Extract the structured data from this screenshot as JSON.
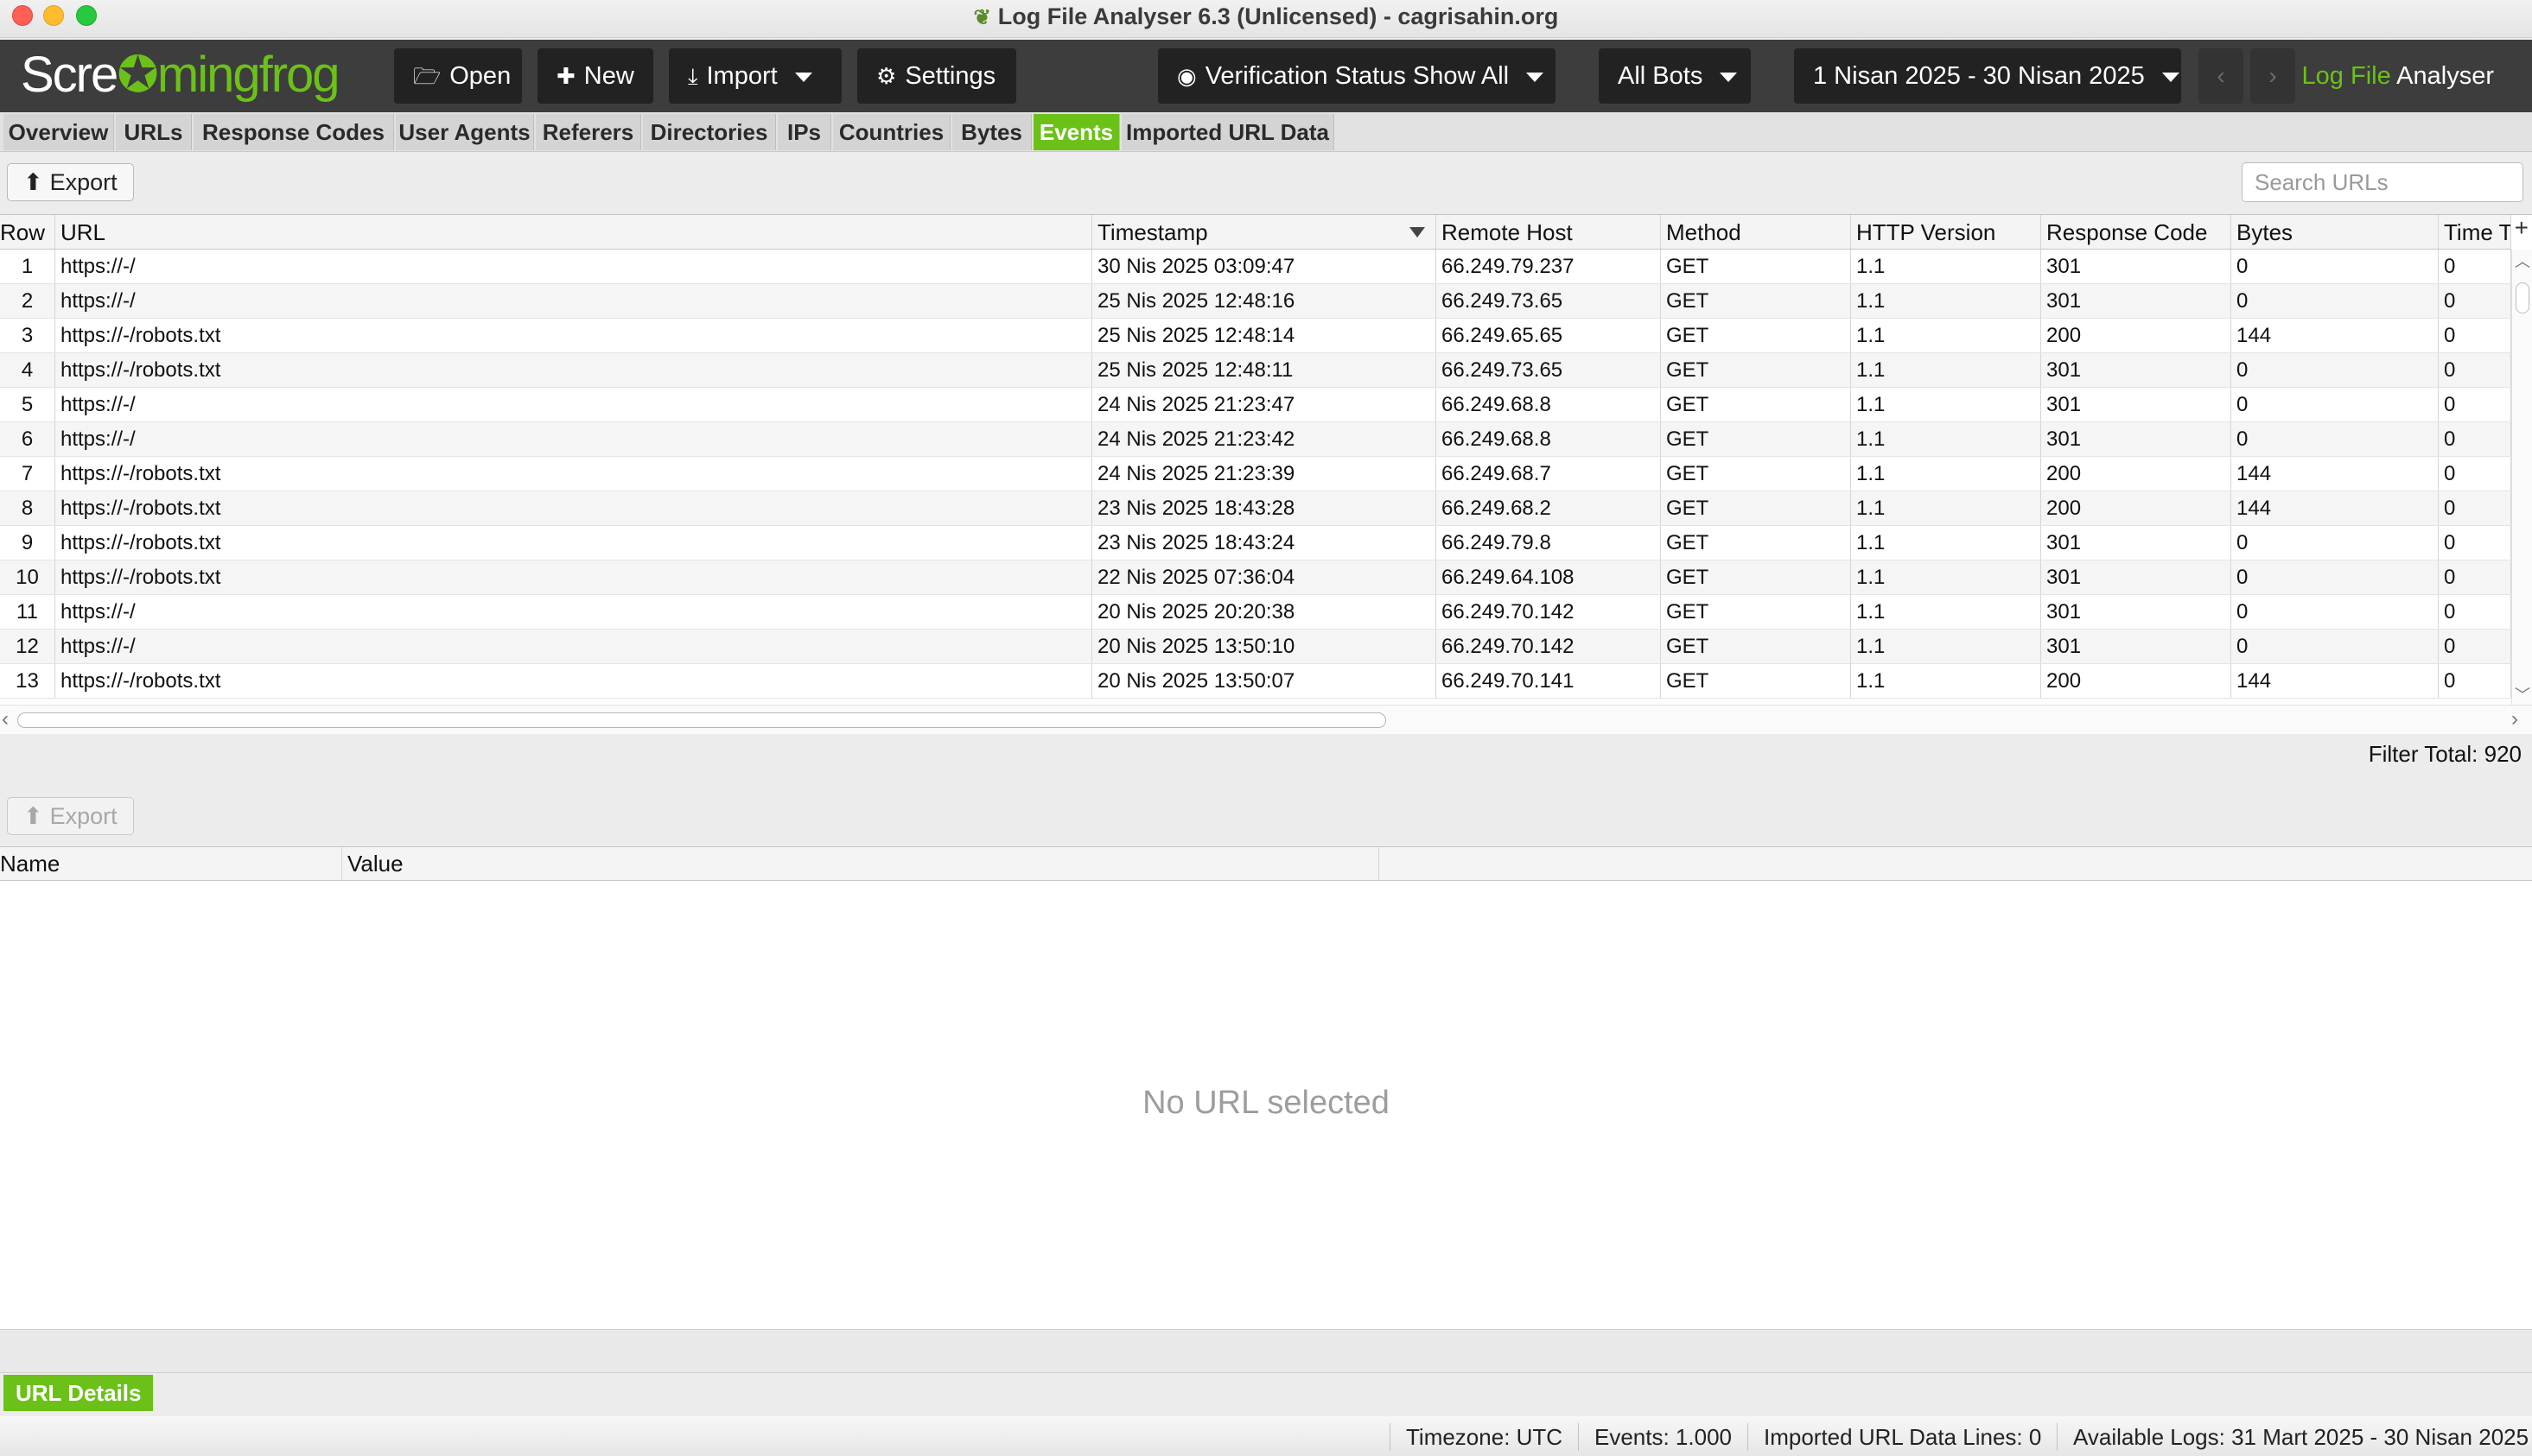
{
  "window": {
    "title": "Log File Analyser 6.3 (Unlicensed) - cagrisahin.org",
    "app_icon": "frog-icon"
  },
  "toolbar": {
    "logo_before": "Scre",
    "logo_glyph": "✪",
    "logo_after": "mingfrog",
    "open_label": "Open",
    "new_label": "New",
    "import_label": "Import",
    "settings_label": "Settings",
    "verification_label": "Verification Status Show All",
    "bots_label": "All Bots",
    "date_range_label": "1 Nisan 2025 - 30 Nisan 2025",
    "prev_glyph": "‹",
    "next_glyph": "›",
    "brand_green": "Log File",
    "brand_white": "Analyser"
  },
  "tabs": [
    {
      "label": "Overview"
    },
    {
      "label": "URLs"
    },
    {
      "label": "Response Codes"
    },
    {
      "label": "User Agents"
    },
    {
      "label": "Referers"
    },
    {
      "label": "Directories"
    },
    {
      "label": "IPs"
    },
    {
      "label": "Countries"
    },
    {
      "label": "Bytes"
    },
    {
      "label": "Events"
    },
    {
      "label": "Imported URL Data"
    }
  ],
  "active_tab": "Events",
  "top_panel": {
    "export_label": "Export",
    "search_placeholder": "Search URLs",
    "filter_total": "Filter Total: 920"
  },
  "table": {
    "columns": [
      "Row",
      "URL",
      "Timestamp",
      "Remote Host",
      "Method",
      "HTTP Version",
      "Response Code",
      "Bytes",
      "Time T"
    ],
    "rows": [
      [
        "1",
        "https://-/",
        "30 Nis 2025 03:09:47",
        "66.249.79.237",
        "GET",
        "1.1",
        "301",
        "0",
        "0"
      ],
      [
        "2",
        "https://-/",
        "25 Nis 2025 12:48:16",
        "66.249.73.65",
        "GET",
        "1.1",
        "301",
        "0",
        "0"
      ],
      [
        "3",
        "https://-/robots.txt",
        "25 Nis 2025 12:48:14",
        "66.249.65.65",
        "GET",
        "1.1",
        "200",
        "144",
        "0"
      ],
      [
        "4",
        "https://-/robots.txt",
        "25 Nis 2025 12:48:11",
        "66.249.73.65",
        "GET",
        "1.1",
        "301",
        "0",
        "0"
      ],
      [
        "5",
        "https://-/",
        "24 Nis 2025 21:23:47",
        "66.249.68.8",
        "GET",
        "1.1",
        "301",
        "0",
        "0"
      ],
      [
        "6",
        "https://-/",
        "24 Nis 2025 21:23:42",
        "66.249.68.8",
        "GET",
        "1.1",
        "301",
        "0",
        "0"
      ],
      [
        "7",
        "https://-/robots.txt",
        "24 Nis 2025 21:23:39",
        "66.249.68.7",
        "GET",
        "1.1",
        "200",
        "144",
        "0"
      ],
      [
        "8",
        "https://-/robots.txt",
        "23 Nis 2025 18:43:28",
        "66.249.68.2",
        "GET",
        "1.1",
        "200",
        "144",
        "0"
      ],
      [
        "9",
        "https://-/robots.txt",
        "23 Nis 2025 18:43:24",
        "66.249.79.8",
        "GET",
        "1.1",
        "301",
        "0",
        "0"
      ],
      [
        "10",
        "https://-/robots.txt",
        "22 Nis 2025 07:36:04",
        "66.249.64.108",
        "GET",
        "1.1",
        "301",
        "0",
        "0"
      ],
      [
        "11",
        "https://-/",
        "20 Nis 2025 20:20:38",
        "66.249.70.142",
        "GET",
        "1.1",
        "301",
        "0",
        "0"
      ],
      [
        "12",
        "https://-/",
        "20 Nis 2025 13:50:10",
        "66.249.70.142",
        "GET",
        "1.1",
        "301",
        "0",
        "0"
      ],
      [
        "13",
        "https://-/robots.txt",
        "20 Nis 2025 13:50:07",
        "66.249.70.141",
        "GET",
        "1.1",
        "200",
        "144",
        "0"
      ]
    ],
    "add_column_glyph": "+"
  },
  "details_panel": {
    "export_label": "Export",
    "columns": [
      "Name",
      "Value"
    ],
    "empty_message": "No URL selected",
    "tab_label": "URL Details"
  },
  "status_bar": {
    "timezone": "Timezone:  UTC",
    "events": "Events:  1.000",
    "imported_lines": "Imported URL Data Lines:  0",
    "available_logs": "Available Logs:  31 Mart 2025 - 30 Nisan 2025"
  },
  "colors": {
    "accent_green": "#6cc119",
    "toolbar_bg": "#3d3d3d",
    "button_bg": "#222222"
  }
}
